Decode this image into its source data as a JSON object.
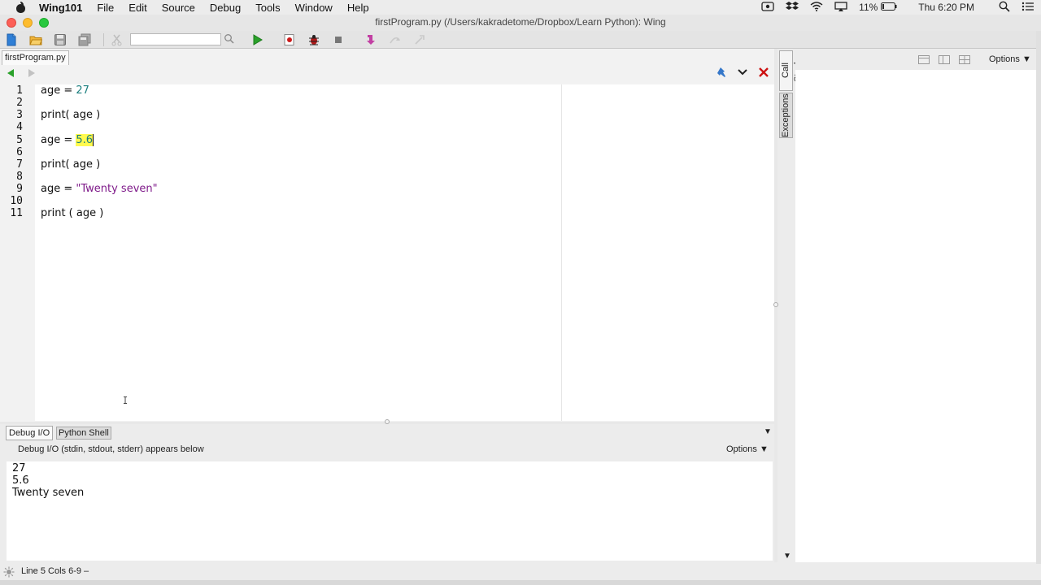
{
  "menubar": {
    "app_name": "Wing101",
    "items": [
      "File",
      "Edit",
      "Source",
      "Debug",
      "Tools",
      "Window",
      "Help"
    ],
    "battery": "11%",
    "clock": "Thu 6:20 PM"
  },
  "window": {
    "title": "firstProgram.py (/Users/kakradetome/Dropbox/Learn Python): Wing"
  },
  "toolbar": {
    "search_value": ""
  },
  "editor": {
    "file_tab": "firstProgram.py",
    "line_numbers": [
      "1",
      "2",
      "3",
      "4",
      "5",
      "6",
      "7",
      "8",
      "9",
      "10",
      "11"
    ],
    "lines": {
      "l1_code": "age = ",
      "l1_num": "27",
      "l3": "print( age )",
      "l5_code": "age = ",
      "l5_sel": "5.6",
      "l7": "print( age )",
      "l9_code": "age = ",
      "l9_str": "\"Twenty seven\"",
      "l11": "print ( age )"
    }
  },
  "bottom_panel": {
    "tabs": [
      "Debug I/O",
      "Python Shell"
    ],
    "caption": "Debug I/O (stdin, stdout, stderr) appears below",
    "options_label": "Options",
    "output": [
      "27",
      "5.6",
      "Twenty seven"
    ]
  },
  "right_panel": {
    "vertical_tabs": [
      "Call Stack",
      "Exceptions"
    ],
    "options_label": "Options"
  },
  "statusbar": {
    "text": "Line 5 Cols 6-9 –"
  },
  "colors": {
    "selection_highlight": "#fffa4f",
    "number_color": "#1b7e7e",
    "string_color": "#7f1b8a",
    "run_green": "#2aa12a",
    "close_red": "#cc1111"
  }
}
